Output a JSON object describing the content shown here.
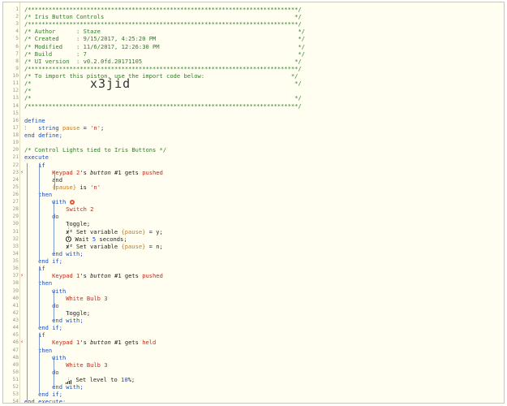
{
  "editor": {
    "lines": [
      {
        "n": "1",
        "tokens": [
          {
            "t": "/******************************************************************************/",
            "c": "comment"
          }
        ]
      },
      {
        "n": "2",
        "tokens": [
          {
            "t": "/* Iris Button Controls                                                       */",
            "c": "comment"
          }
        ]
      },
      {
        "n": "3",
        "tokens": [
          {
            "t": "/******************************************************************************/",
            "c": "comment"
          }
        ]
      },
      {
        "n": "4",
        "tokens": [
          {
            "t": "/* Author      : Staze                                                         */",
            "c": "comment"
          }
        ]
      },
      {
        "n": "5",
        "tokens": [
          {
            "t": "/* Created     : 9/15/2017, 4:25:20 PM                                         */",
            "c": "comment"
          }
        ]
      },
      {
        "n": "6",
        "tokens": [
          {
            "t": "/* Modified    : 11/6/2017, 12:26:30 PM                                        */",
            "c": "comment"
          }
        ]
      },
      {
        "n": "7",
        "tokens": [
          {
            "t": "/* Build       : 7                                                             */",
            "c": "comment"
          }
        ]
      },
      {
        "n": "8",
        "tokens": [
          {
            "t": "/* UI version  : v0.2.0fd.20171105                                            */",
            "c": "comment"
          }
        ]
      },
      {
        "n": "9",
        "tokens": [
          {
            "t": "/******************************************************************************/",
            "c": "comment"
          }
        ]
      },
      {
        "n": "10",
        "tokens": [
          {
            "t": "/* To import this piston, use the import code below:                         */",
            "c": "comment"
          }
        ]
      },
      {
        "n": "11",
        "tokens": [
          {
            "t": "/*                                                                            */",
            "c": "comment"
          }
        ]
      },
      {
        "n": "12",
        "tokens": [
          {
            "t": "/*",
            "c": "comment"
          }
        ]
      },
      {
        "n": "13",
        "tokens": [
          {
            "t": "/*                                                                            */",
            "c": "comment"
          }
        ]
      },
      {
        "n": "14",
        "tokens": [
          {
            "t": "/******************************************************************************/",
            "c": "comment"
          }
        ]
      },
      {
        "n": "15",
        "tokens": []
      },
      {
        "n": "16",
        "tokens": [
          {
            "t": "define",
            "c": "kw"
          }
        ]
      },
      {
        "n": "17",
        "tokens": [
          {
            "t": "    string ",
            "c": "type"
          },
          {
            "t": "pause",
            "c": "var"
          },
          {
            "t": " = ",
            "c": "cmd"
          },
          {
            "t": "'n'",
            "c": "str"
          },
          {
            "t": ";",
            "c": "cmd"
          }
        ]
      },
      {
        "n": "18",
        "tokens": [
          {
            "t": "end define;",
            "c": "kw"
          }
        ]
      },
      {
        "n": "19",
        "tokens": []
      },
      {
        "n": "20",
        "tokens": [
          {
            "t": "/* Control Lights tied to Iris Buttons */",
            "c": "comment"
          }
        ]
      },
      {
        "n": "21",
        "tokens": [
          {
            "t": "execute",
            "c": "kw"
          }
        ]
      },
      {
        "n": "22",
        "tokens": [
          {
            "t": "    if",
            "c": "kw"
          }
        ]
      },
      {
        "n": "23",
        "tokens": [
          {
            "t": "        Keypad 2",
            "c": "dev"
          },
          {
            "t": "'s ",
            "c": "cmd"
          },
          {
            "t": "button",
            "c": "ital"
          },
          {
            "t": " #1 gets ",
            "c": "cmd"
          },
          {
            "t": "pushed",
            "c": "red"
          }
        ]
      },
      {
        "n": "24",
        "tokens": [
          {
            "t": "        and",
            "c": "cmd"
          }
        ]
      },
      {
        "n": "25",
        "tokens": [
          {
            "t": "        {pause}",
            "c": "var"
          },
          {
            "t": " is ",
            "c": "cmd"
          },
          {
            "t": "'n'",
            "c": "str"
          }
        ]
      },
      {
        "n": "26",
        "tokens": [
          {
            "t": "    then",
            "c": "kw"
          }
        ]
      },
      {
        "n": "27",
        "tokens": [
          {
            "t": "        with ",
            "c": "kw"
          },
          {
            "t": "",
            "c": "gear"
          }
        ]
      },
      {
        "n": "28",
        "tokens": [
          {
            "t": "            Switch 2",
            "c": "dev"
          }
        ]
      },
      {
        "n": "29",
        "tokens": [
          {
            "t": "        do",
            "c": "kw"
          }
        ]
      },
      {
        "n": "30",
        "tokens": [
          {
            "t": "            Toggle;",
            "c": "cmd"
          }
        ]
      },
      {
        "n": "31",
        "tokens": [
          {
            "t": "            ",
            "c": "cmd"
          },
          {
            "t": "x²",
            "c": "xvar"
          },
          {
            "t": " Set variable ",
            "c": "cmd"
          },
          {
            "t": "{pause}",
            "c": "var"
          },
          {
            "t": " = y;",
            "c": "cmd"
          }
        ]
      },
      {
        "n": "32",
        "tokens": [
          {
            "t": "            ",
            "c": "cmd"
          },
          {
            "t": "",
            "c": "clock"
          },
          {
            "t": " Wait ",
            "c": "cmd"
          },
          {
            "t": "5",
            "c": "kw"
          },
          {
            "t": " seconds;",
            "c": "cmd"
          }
        ]
      },
      {
        "n": "33",
        "tokens": [
          {
            "t": "            ",
            "c": "cmd"
          },
          {
            "t": "x²",
            "c": "xvar"
          },
          {
            "t": " Set variable ",
            "c": "cmd"
          },
          {
            "t": "{pause}",
            "c": "var"
          },
          {
            "t": " = n;",
            "c": "cmd"
          }
        ]
      },
      {
        "n": "34",
        "tokens": [
          {
            "t": "        end with;",
            "c": "kw"
          }
        ]
      },
      {
        "n": "35",
        "tokens": [
          {
            "t": "    end if;",
            "c": "kw"
          }
        ]
      },
      {
        "n": "36",
        "tokens": [
          {
            "t": "    if",
            "c": "kw"
          }
        ]
      },
      {
        "n": "37",
        "tokens": [
          {
            "t": "        Keypad 1",
            "c": "dev"
          },
          {
            "t": "'s ",
            "c": "cmd"
          },
          {
            "t": "button",
            "c": "ital"
          },
          {
            "t": " #1 gets ",
            "c": "cmd"
          },
          {
            "t": "pushed",
            "c": "red"
          }
        ]
      },
      {
        "n": "38",
        "tokens": [
          {
            "t": "    then",
            "c": "kw"
          }
        ]
      },
      {
        "n": "39",
        "tokens": [
          {
            "t": "        with",
            "c": "kw"
          }
        ]
      },
      {
        "n": "40",
        "tokens": [
          {
            "t": "            White Bulb 3",
            "c": "dev"
          }
        ]
      },
      {
        "n": "41",
        "tokens": [
          {
            "t": "        do",
            "c": "kw"
          }
        ]
      },
      {
        "n": "42",
        "tokens": [
          {
            "t": "            Toggle;",
            "c": "cmd"
          }
        ]
      },
      {
        "n": "43",
        "tokens": [
          {
            "t": "        end with;",
            "c": "kw"
          }
        ]
      },
      {
        "n": "44",
        "tokens": [
          {
            "t": "    end if;",
            "c": "kw"
          }
        ]
      },
      {
        "n": "45",
        "tokens": [
          {
            "t": "    if",
            "c": "kw"
          }
        ]
      },
      {
        "n": "46",
        "tokens": [
          {
            "t": "        Keypad 1",
            "c": "dev"
          },
          {
            "t": "'s ",
            "c": "cmd"
          },
          {
            "t": "button",
            "c": "ital"
          },
          {
            "t": " #1 gets ",
            "c": "cmd"
          },
          {
            "t": "held",
            "c": "red"
          }
        ]
      },
      {
        "n": "47",
        "tokens": [
          {
            "t": "    then",
            "c": "kw"
          }
        ]
      },
      {
        "n": "48",
        "tokens": [
          {
            "t": "        with",
            "c": "kw"
          }
        ]
      },
      {
        "n": "49",
        "tokens": [
          {
            "t": "            White Bulb 3",
            "c": "dev"
          }
        ]
      },
      {
        "n": "50",
        "tokens": [
          {
            "t": "        do",
            "c": "kw"
          }
        ]
      },
      {
        "n": "51",
        "tokens": [
          {
            "t": "            ",
            "c": "cmd"
          },
          {
            "t": "",
            "c": "signal"
          },
          {
            "t": " Set level to ",
            "c": "cmd"
          },
          {
            "t": "10",
            "c": "kw"
          },
          {
            "t": "%;",
            "c": "cmd"
          }
        ]
      },
      {
        "n": "52",
        "tokens": [
          {
            "t": "        end with;",
            "c": "kw"
          }
        ]
      },
      {
        "n": "53",
        "tokens": [
          {
            "t": "    end if;",
            "c": "kw"
          }
        ]
      },
      {
        "n": "54",
        "tokens": [
          {
            "t": "end execute;",
            "c": "kw"
          }
        ]
      }
    ],
    "import_code": "x3jid",
    "markers": [
      "23",
      "37",
      "46"
    ],
    "marker_glyph": "⚡"
  },
  "colors": {
    "comment": "#2c7e26",
    "keyword": "#1a4ec4",
    "variable": "#c47a1a",
    "string": "#c42a1a",
    "background": "#fffef0"
  }
}
